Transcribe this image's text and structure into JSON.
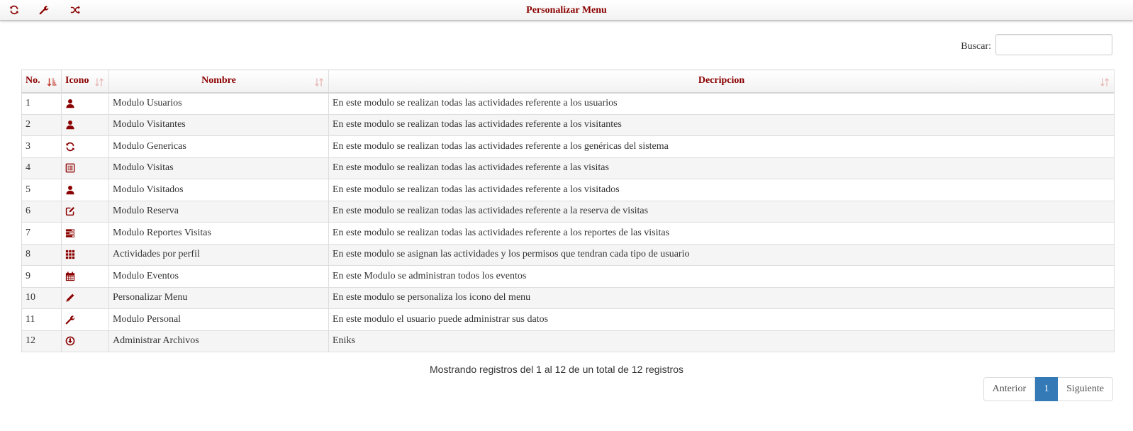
{
  "topbar": {
    "title": "Personalizar Menu",
    "buttons": [
      {
        "icon": "refresh-icon"
      },
      {
        "icon": "wrench-icon"
      },
      {
        "icon": "random-icon"
      }
    ]
  },
  "search": {
    "label": "Buscar:",
    "value": "",
    "placeholder": ""
  },
  "table": {
    "columns": [
      "No.",
      "Icono",
      "Nombre",
      "Decripcion"
    ],
    "rows": [
      {
        "no": "1",
        "icon": "user-icon",
        "name": "Modulo Usuarios",
        "desc": "En este modulo se realizan todas las actividades referente a los usuarios"
      },
      {
        "no": "2",
        "icon": "user-icon",
        "name": "Modulo Visitantes",
        "desc": "En este modulo se realizan todas las actividades referente a los visitantes"
      },
      {
        "no": "3",
        "icon": "refresh-icon",
        "name": "Modulo Genericas",
        "desc": "En este modulo se realizan todas las actividades referente a los genéricas del sistema"
      },
      {
        "no": "4",
        "icon": "list-alt-icon",
        "name": "Modulo Visitas",
        "desc": "En este modulo se realizan todas las actividades referente a las visitas"
      },
      {
        "no": "5",
        "icon": "user-icon",
        "name": "Modulo Visitados",
        "desc": "En este modulo se realizan todas las actividades referente a los visitados"
      },
      {
        "no": "6",
        "icon": "edit-icon",
        "name": "Modulo Reserva",
        "desc": "En este modulo se realizan todas las actividades referente a la reserva de visitas"
      },
      {
        "no": "7",
        "icon": "tasks-icon",
        "name": "Modulo Reportes Visitas",
        "desc": "En este modulo se realizan todas las actividades referente a los reportes de las visitas"
      },
      {
        "no": "8",
        "icon": "th-icon",
        "name": "Actividades por perfil",
        "desc": "En este modulo se asignan las actividades y los permisos que tendran cada tipo de usuario"
      },
      {
        "no": "9",
        "icon": "calendar-icon",
        "name": "Modulo Eventos",
        "desc": "En este Modulo se administran todos los eventos"
      },
      {
        "no": "10",
        "icon": "pencil-icon",
        "name": "Personalizar Menu",
        "desc": "En este modulo se personaliza los icono del menu"
      },
      {
        "no": "11",
        "icon": "wrench-icon",
        "name": "Modulo Personal",
        "desc": "En este modulo el usuario puede administrar sus datos"
      },
      {
        "no": "12",
        "icon": "download-icon",
        "name": "Administrar Archivos",
        "desc": "Eniks"
      }
    ]
  },
  "info": "Mostrando registros del 1 al 12 de un total de 12 registros",
  "pagination": {
    "prev": "Anterior",
    "current": "1",
    "next": "Siguiente"
  },
  "colors": {
    "accent": "#8b0000",
    "active_page": "#337ab7"
  }
}
